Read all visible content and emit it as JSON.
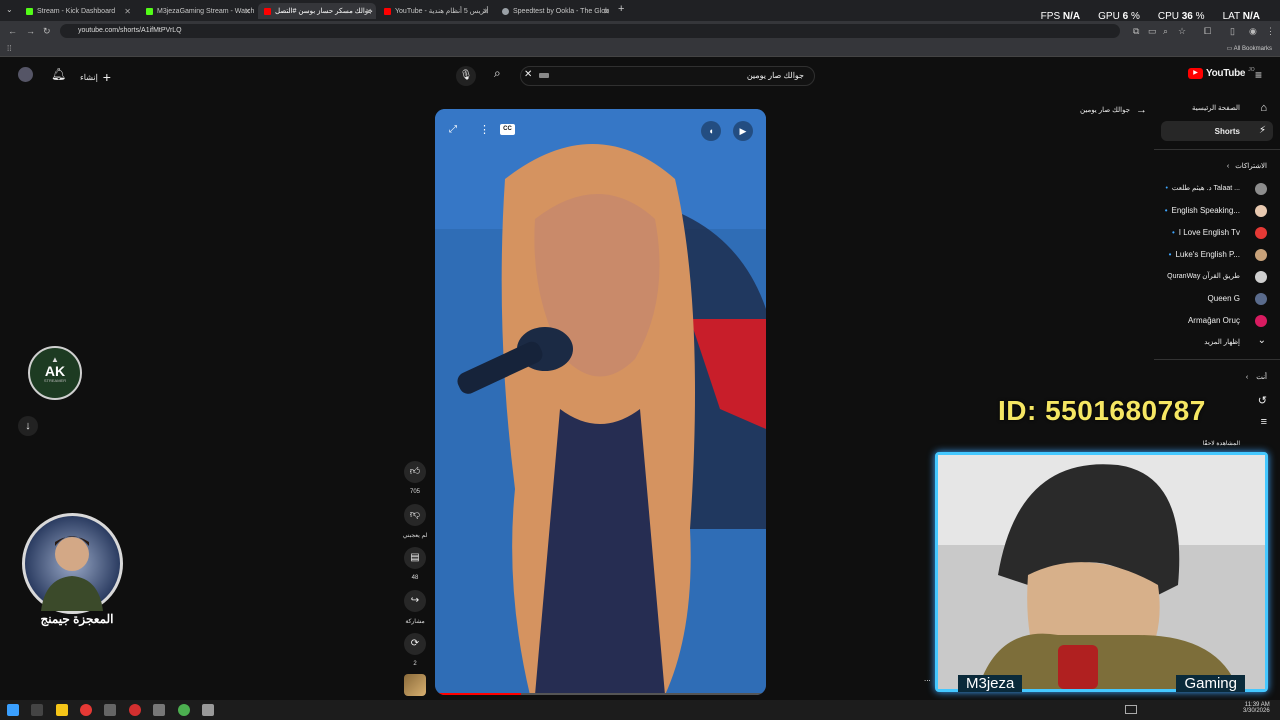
{
  "browser": {
    "tabs": [
      {
        "label": "Stream - Kick Dashboard",
        "color": "#53fc18",
        "active": false
      },
      {
        "label": "M3jezaGaming Stream - Watch",
        "color": "#53fc18",
        "active": false
      },
      {
        "label": "جوالك مسكر حساز بوسن #التصل",
        "color": "#ff0000",
        "active": true
      },
      {
        "label": "YouTube - أثريس 5 أنظام هندية",
        "color": "#ff0000",
        "active": false
      },
      {
        "label": "Speedtest by Ookla - The Glob",
        "color": "#9aa0a6",
        "active": false
      }
    ],
    "new_tab": "+",
    "url": "youtube.com/shorts/A1ifMtPVrLQ",
    "bookmarks_label": "All Bookmarks"
  },
  "stats": {
    "fps_label": "FPS",
    "fps_value": "N/A",
    "gpu_label": "GPU",
    "gpu_value": "6",
    "cpu_label": "CPU",
    "cpu_value": "36",
    "lat_label": "LAT",
    "lat_value": "N/A",
    "percent": "%"
  },
  "yt": {
    "logo": "YouTube",
    "logo_region": "JO",
    "create_label": "إنشاء",
    "search_value": "جوالك صار يومين",
    "back_query": "جوالك صار يومين"
  },
  "sidebar": {
    "home": "الصفحة الرئيسية",
    "shorts": "Shorts",
    "subscriptions": "الاشتراكات",
    "channels": [
      {
        "name": "د. هيثم طلعت Talaat ...",
        "color": "#8d8d8d",
        "dot": true
      },
      {
        "name": "English Speaking...",
        "color": "#e8c9b0",
        "dot": true
      },
      {
        "name": "I Love English Tv",
        "color": "#e53935",
        "dot": true
      },
      {
        "name": "Luke's English P...",
        "color": "#c8a27a",
        "dot": true
      },
      {
        "name": "QuranWay طريق القرآن",
        "color": "#cfcfcf",
        "dot": false
      },
      {
        "name": "Queen G",
        "color": "#5a6b8c",
        "dot": false
      },
      {
        "name": "Armağan Oruç",
        "color": "#d81b60",
        "dot": false
      }
    ],
    "show_more": "إظهار المزيد",
    "you": "أنت",
    "watch_later": "المشاهدة لاحقًا"
  },
  "actions": {
    "likes": "705",
    "dislike": "لم يعجبني",
    "comments": "48",
    "share": "مشاركة",
    "remix": "2"
  },
  "overlay": {
    "id_text": "ID: 5501680787",
    "logo_text": "AK",
    "logo_sub": "STREAMER",
    "streamer_name": "المعجزة جيمنج",
    "cam_left": "M3jeza",
    "cam_right": "Gaming",
    "ellipsis": "..."
  },
  "taskbar": {
    "time": "11:39 AM",
    "date": "3/30/2026"
  },
  "colors": {
    "yt_red": "#ff0000",
    "accent_blue": "#3ea6ff",
    "id_yellow": "#f5e663"
  }
}
